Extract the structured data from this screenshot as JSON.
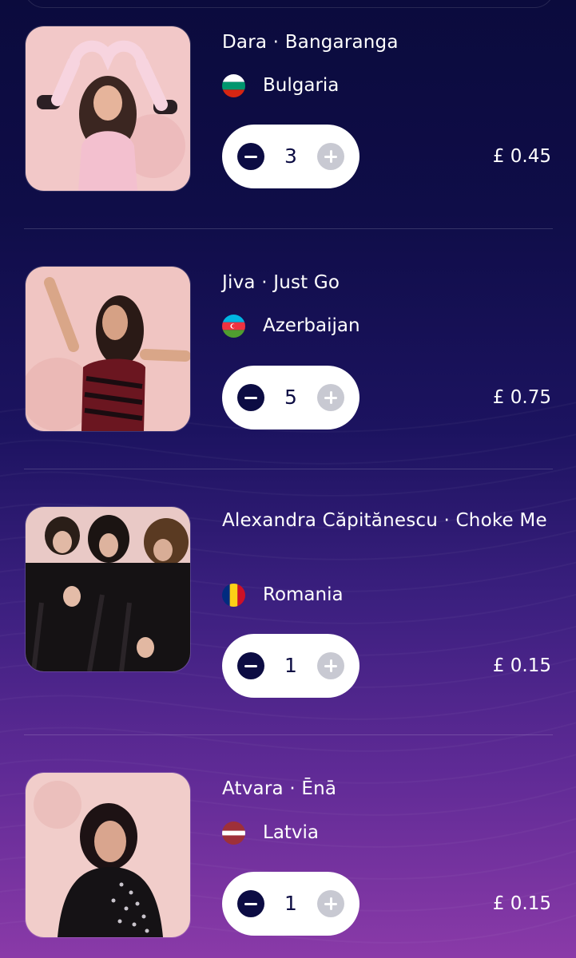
{
  "entries": [
    {
      "title": "Dara · Bangaranga",
      "country": "Bulgaria",
      "flag_icon": "bulgaria-flag-icon",
      "quantity": "3",
      "price": "£ 0.45"
    },
    {
      "title": "Jiva · Just Go",
      "country": "Azerbaijan",
      "flag_icon": "azerbaijan-flag-icon",
      "quantity": "5",
      "price": "£ 0.75"
    },
    {
      "title": "Alexandra Căpitănescu · Choke Me",
      "country": "Romania",
      "flag_icon": "romania-flag-icon",
      "quantity": "1",
      "price": "£ 0.15"
    },
    {
      "title": "Atvara · Ēnā",
      "country": "Latvia",
      "flag_icon": "latvia-flag-icon",
      "quantity": "1",
      "price": "£ 0.15"
    }
  ],
  "stepper": {
    "decrement_icon": "minus-icon",
    "increment_icon": "plus-icon"
  },
  "colors": {
    "background_top": "#0b0b3d",
    "background_bottom": "#8a3aa8",
    "stepper_bg": "#ffffff",
    "minus_button": "#0c0c43",
    "plus_button_disabled": "#c8c9d2"
  }
}
